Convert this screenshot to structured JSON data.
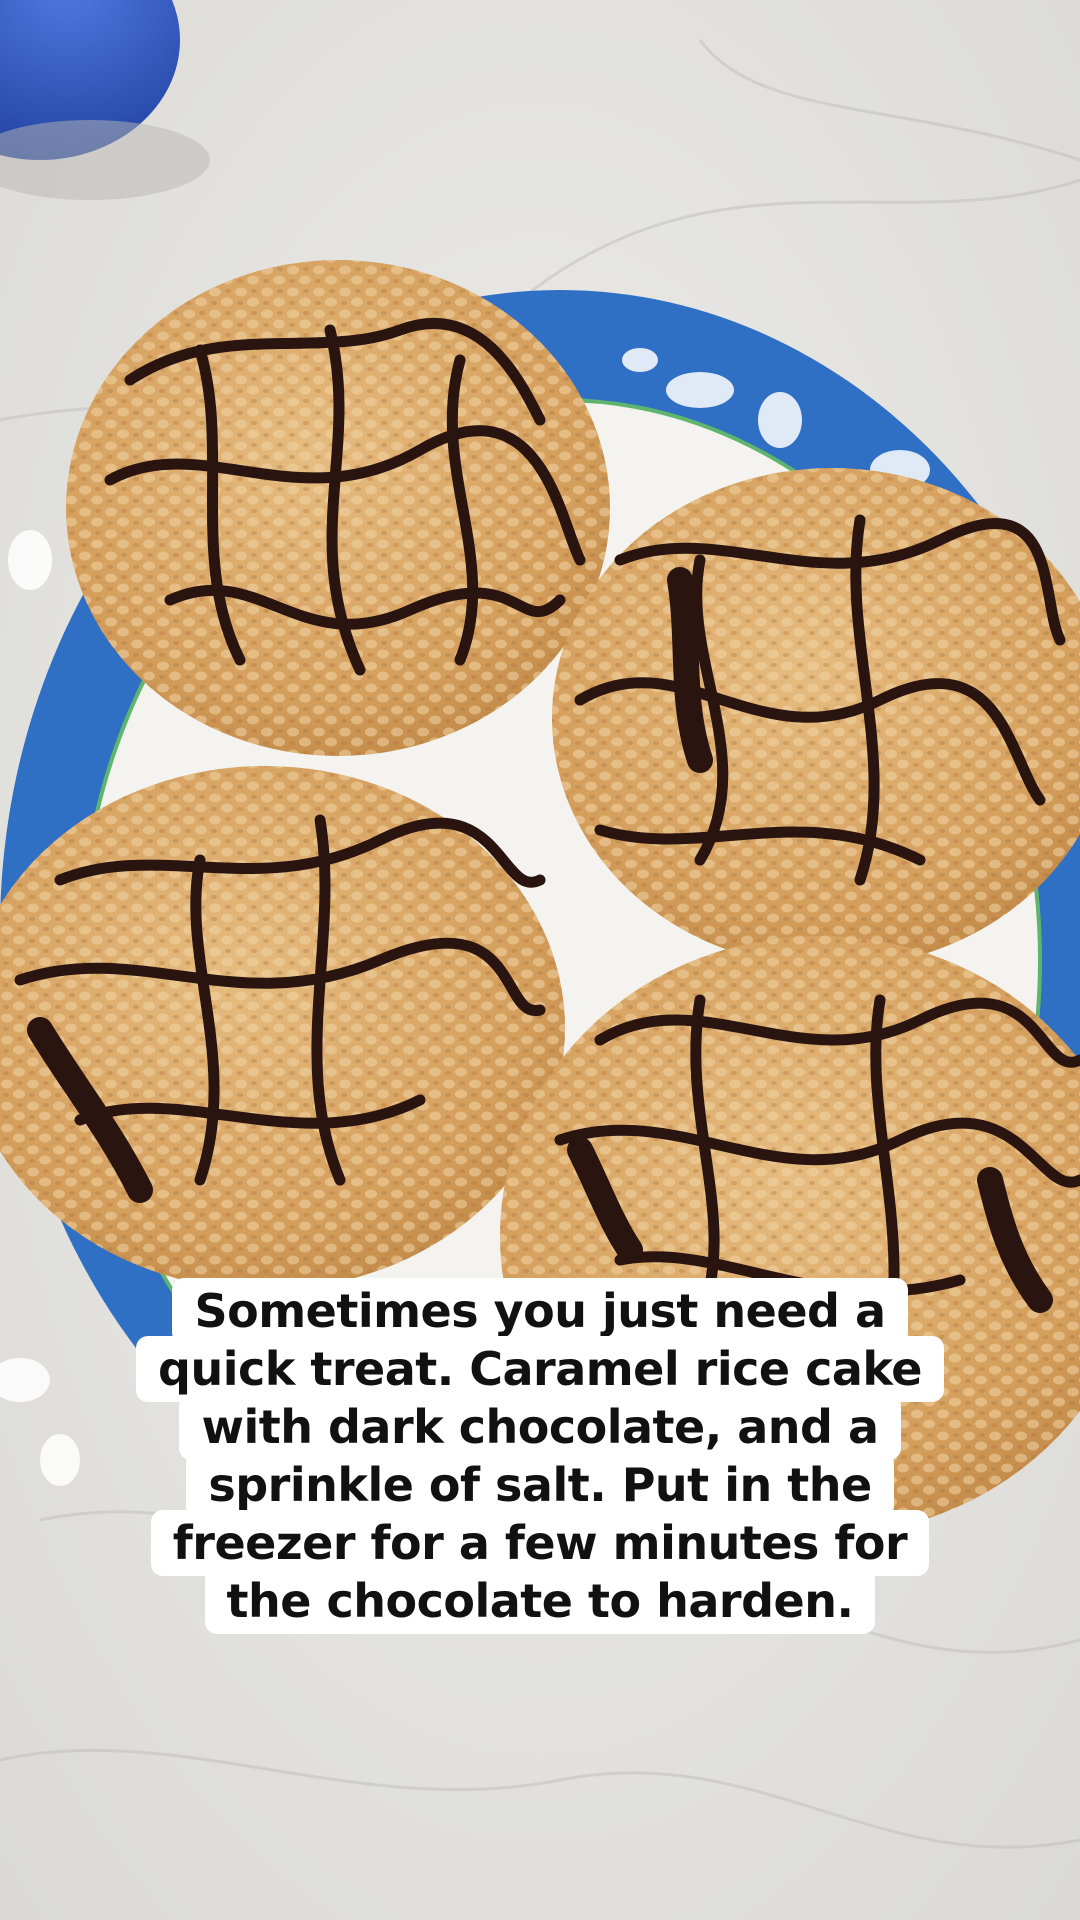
{
  "caption": {
    "lines": [
      "Sometimes you just need a",
      "quick treat. Caramel rice cake",
      "with dark chocolate, and a",
      "sprinkle of salt. Put in the",
      "freezer for a few minutes for",
      "the chocolate to harden."
    ]
  },
  "scene": {
    "subject": "rice-cakes-with-chocolate-drizzle",
    "colors": {
      "counter": "#e3e2df",
      "plate_rim": "#2f6fc4",
      "plate_center": "#f4f3ef",
      "rice_cake": "#d9a766",
      "chocolate": "#2a1410",
      "bowl": "#2b55c9"
    }
  }
}
